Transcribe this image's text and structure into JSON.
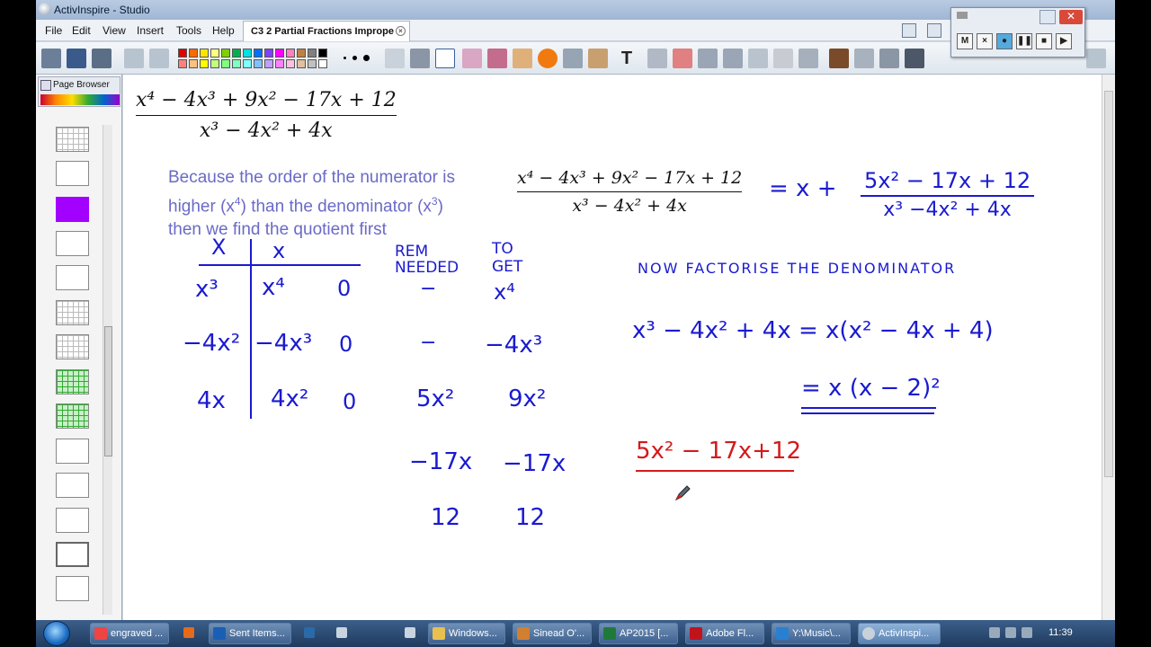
{
  "window": {
    "title": "ActivInspire - Studio"
  },
  "menu": [
    "File",
    "Edit",
    "View",
    "Insert",
    "Tools",
    "Help"
  ],
  "document_tab": "C3 2 Partial Fractions Imprope",
  "page_browser": {
    "title": "Page Browser"
  },
  "swatch_colors": [
    "#e00000",
    "#ff6a00",
    "#ffe600",
    "#ffff80",
    "#7fd000",
    "#00b050",
    "#00e0e0",
    "#0070ff",
    "#8040ff",
    "#ff00ff",
    "#ff80c0",
    "#c08040",
    "#808080",
    "#000000",
    "#ff8080",
    "#ffc080",
    "#ffff00",
    "#c0ff80",
    "#80ff80",
    "#80ffc0",
    "#80ffff",
    "#80c0ff",
    "#c0a0ff",
    "#ff80ff",
    "#ffc0e0",
    "#e0c0a0",
    "#c0c0c0",
    "#ffffff"
  ],
  "canvas": {
    "top_fraction": {
      "num": "x⁴ − 4x³ + 9x² − 17x + 12",
      "den": "x³ − 4x² + 4x"
    },
    "explain_1": "Because the order of the numerator is",
    "explain_2": "higher (x",
    "explain_2_sup": "4",
    "explain_2b": ") than the denominator (x",
    "explain_2b_sup": "3",
    "explain_2c": ")",
    "explain_3": "then we find the quotient first",
    "mid_fraction": {
      "num": "x⁴ − 4x³ + 9x² − 17x + 12",
      "den": "x³ − 4x² + 4x"
    },
    "hand": {
      "eq_x": "= x  +",
      "result_num": "5x² − 17x  + 12",
      "result_den": "x³ −4x² + 4x",
      "col_head_1": "X",
      "col_head_2": "x",
      "rem_needed": "REM\nNEEDED",
      "to_get": "TO\nGET",
      "r1c1": "x³",
      "r1c2": "x⁴",
      "r1c3": "0",
      "r1c4": "−",
      "r1c5": "x⁴",
      "r2c1": "−4x²",
      "r2c2": "−4x³",
      "r2c3": "0",
      "r2c4": "−",
      "r2c5": "−4x³",
      "r3c1": "4x",
      "r3c2": "4x²",
      "r3c3": "0",
      "r3c4": "5x²",
      "r3c5": "9x²",
      "r4c4": "−17x",
      "r4c5": "−17x",
      "r5c4": "12",
      "r5c5": "12",
      "factorise": "NOW  FACTORISE  THE  DENOMINATOR",
      "fact_line1": "x³ − 4x² + 4x = x(x² − 4x + 4)",
      "fact_line2": "= x (x − 2)²",
      "red_expr": "5x² − 17x+12"
    }
  },
  "recorder": {
    "m_label": "M",
    "x_label": "×"
  },
  "taskbar": {
    "tasks": [
      "engraved ...",
      "Sent Items...",
      "Windows...",
      "Sinead O'...",
      "AP2015  [...",
      "Adobe Fl...",
      "Y:\\Music\\...",
      "ActivInspi..."
    ],
    "clock": "11:39"
  }
}
